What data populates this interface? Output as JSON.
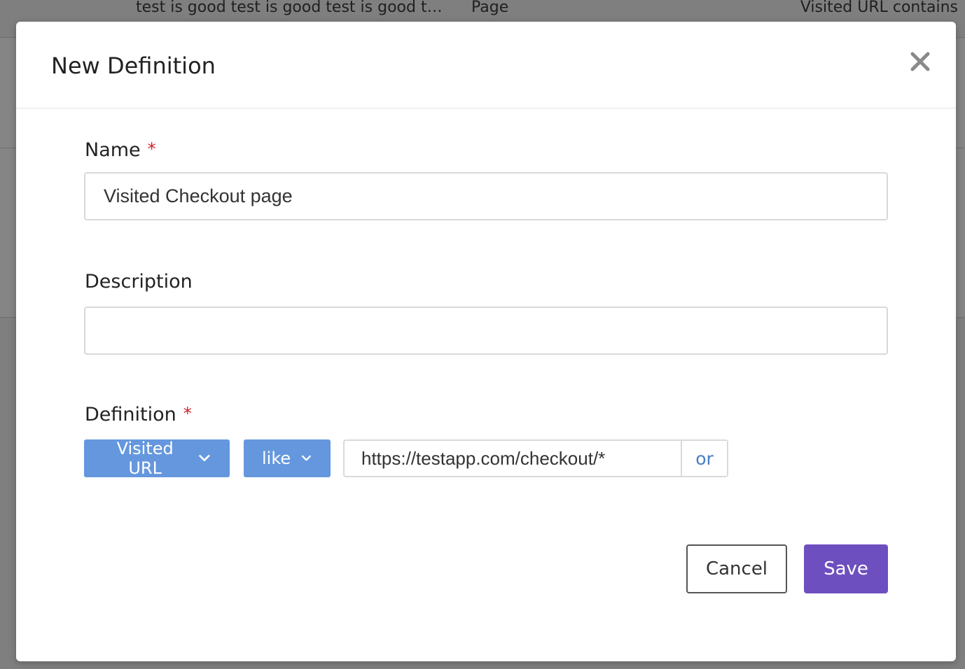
{
  "background": {
    "row_cells": [
      "test is good test is good test is good t…",
      "Page",
      "Visited URL contains"
    ]
  },
  "modal": {
    "title": "New Definition",
    "close_icon": "close-icon",
    "name": {
      "label": "Name",
      "required_mark": "*",
      "value": "Visited Checkout page"
    },
    "description": {
      "label": "Description",
      "value": ""
    },
    "definition": {
      "label": "Definition",
      "required_mark": "*",
      "field_select": "Visited URL",
      "operator_select": "like",
      "value": "https://testapp.com/checkout/*",
      "or_label": "or"
    },
    "buttons": {
      "cancel": "Cancel",
      "save": "Save"
    }
  },
  "colors": {
    "accent_blue": "#6497dd",
    "save_purple": "#6e4fbf",
    "required_red": "#d0202a",
    "link_blue": "#4a7cc4"
  }
}
